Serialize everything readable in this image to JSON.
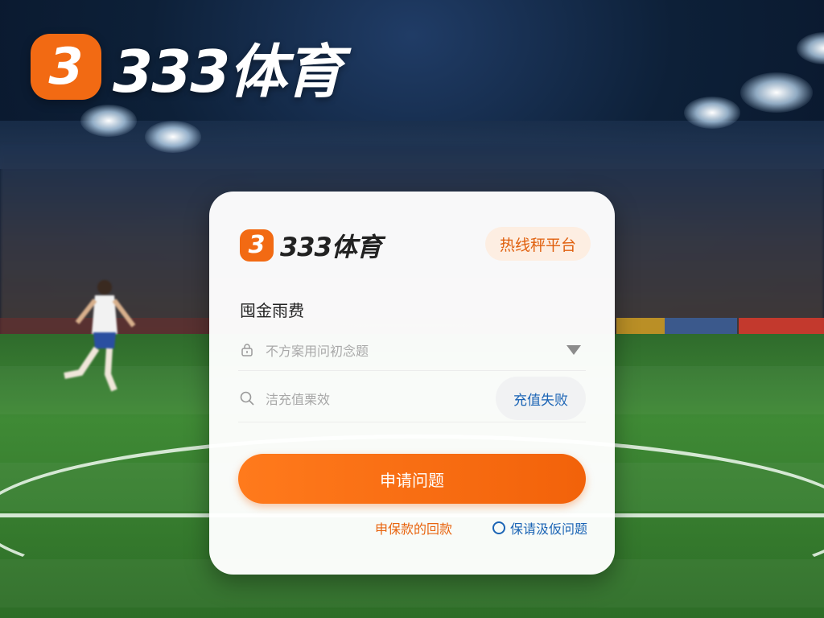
{
  "brand": {
    "badge": "3",
    "name": "333体育"
  },
  "card": {
    "brand_badge": "3",
    "brand_name": "333体育",
    "hotline": "热线秤平台",
    "section_title": "囤金雨费",
    "field1": {
      "icon": "lock-icon",
      "placeholder": "不方案用问初念题",
      "control": "dropdown"
    },
    "field2": {
      "icon": "search-icon",
      "placeholder": "洁充值栗效",
      "button": "充值失败"
    },
    "submit": "申请问题",
    "link_left": "申保款的回款",
    "link_right": "保请汲仮问题"
  },
  "colors": {
    "accent": "#f26a13",
    "link_blue": "#1b64b5",
    "pitch": "#3f8a35"
  }
}
